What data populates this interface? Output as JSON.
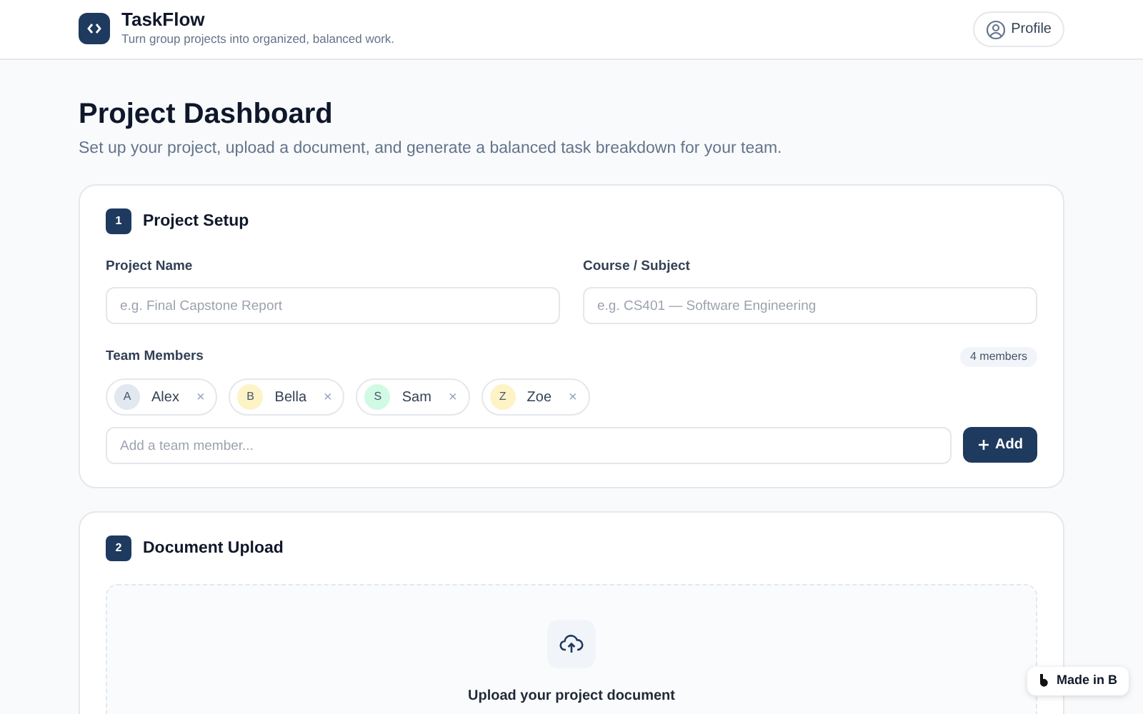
{
  "header": {
    "app_name": "TaskFlow",
    "tagline": "Turn group projects into organized, balanced work.",
    "profile_button": "Profile"
  },
  "page": {
    "title": "Project Dashboard",
    "subtitle": "Set up your project, upload a document, and generate a balanced task breakdown for your team."
  },
  "setup": {
    "step": "1",
    "title": "Project Setup",
    "fields": [
      {
        "label": "Project Name",
        "placeholder": "e.g. Final Capstone Report"
      },
      {
        "label": "Course / Subject",
        "placeholder": "e.g. CS401 — Software Engineering"
      }
    ],
    "team_label": "Team Members",
    "member_count": "4 members",
    "members": [
      {
        "initial": "A",
        "name": "Alex",
        "color": "#e2e8f0",
        "remove": "×"
      },
      {
        "initial": "B",
        "name": "Bella",
        "color": "#fef3c7",
        "remove": "×"
      },
      {
        "initial": "S",
        "name": "Sam",
        "color": "#d1fae5",
        "remove": "×"
      },
      {
        "initial": "Z",
        "name": "Zoe",
        "color": "#fef3c7",
        "remove": "×"
      }
    ],
    "add_placeholder": "Add a team member...",
    "add_button": "Add"
  },
  "upload": {
    "step": "2",
    "title": "Document Upload",
    "prompt": "Upload your project document"
  },
  "badge": {
    "text": "Made in B"
  }
}
